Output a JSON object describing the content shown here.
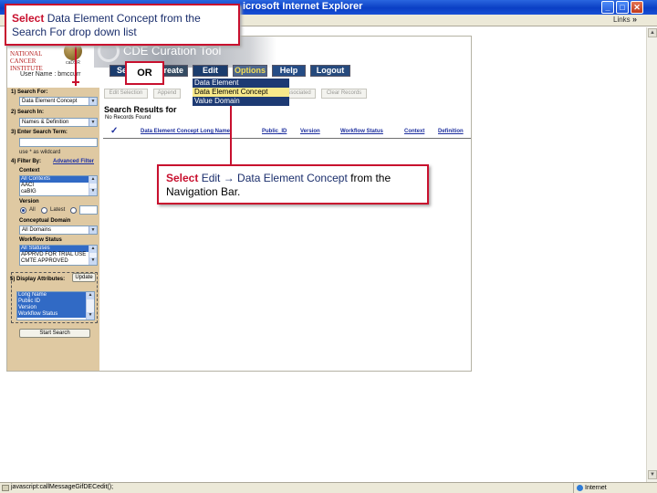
{
  "window": {
    "title": "CDE Curation Tool - Microsoft Internet Explorer",
    "visible_title": "icrosoft Internet Explorer"
  },
  "ie": {
    "links_label": "Links",
    "chevron": "»"
  },
  "header": {
    "nci_logo_text": "NATIONAL CANCER INSTITUTE",
    "cadsr_label": "caDSR",
    "app_title": "CDE Curation Tool",
    "username": "User Name : bmccurr"
  },
  "nav": {
    "search_label": "Search",
    "create_label": "Create",
    "edit_label": "Edit",
    "options_label": "Options",
    "help_label": "Help",
    "logout_label": "Logout",
    "dropdown": [
      {
        "label": "Data Element",
        "highlighted": false
      },
      {
        "label": "Data Element Concept",
        "highlighted": true
      },
      {
        "label": "Value Domain",
        "highlighted": false
      }
    ]
  },
  "left_panel": {
    "search_for_label": "1) Search For:",
    "search_for_value": "Data Element Concept",
    "search_in_label": "2) Search In:",
    "search_in_value": "Names & Definition",
    "search_term_label": "3) Enter Search Term:",
    "wildcard_note": "use * as wildcard",
    "filter_by_label": "4) Filter By:",
    "advanced_filter_link": "Advanced Filter",
    "context_label": "Context",
    "context_options": [
      "All Contexts",
      "AACI",
      "caBIG"
    ],
    "version_label": "Version",
    "version_all": "All",
    "version_latest": "Latest",
    "conceptual_domain_label": "Conceptual Domain",
    "conceptual_domain_value": "All Domains",
    "workflow_status_label": "Workflow Status",
    "workflow_options": [
      "All Statuses",
      "APPRVD FOR TRIAL USE",
      "CMTE APPROVED"
    ],
    "display_attributes_label": "5) Display Attributes:",
    "update_button": "Update",
    "attribute_options": [
      "Long Name",
      "Public ID",
      "Version",
      "Workflow Status"
    ],
    "start_search_button": "Start Search"
  },
  "toolbar": {
    "edit_selection": "Edit Selection",
    "append": "Append",
    "associated": "Associated",
    "clear_records": "Clear Records"
  },
  "results": {
    "title": "Search Results for",
    "no_records": "No Records Found",
    "check_icon": "✓",
    "columns": [
      "Data Element Concept Long Name",
      "Public_ID",
      "Version",
      "Workflow Status",
      "Context",
      "Definition"
    ]
  },
  "annotations": {
    "top": {
      "keyword": "Select",
      "text": " Data Element Concept from the Search For drop down list"
    },
    "or_label": "OR",
    "mid": {
      "keyword": "Select",
      "text_a": " Edit ",
      "arrow": "→",
      "text_b": " Data Element Concept",
      "text_c": " from the Navigation Bar."
    }
  },
  "status_bar": {
    "message": "javascript:callMessageGifDECedit();",
    "zone": "Internet"
  },
  "colors": {
    "accent_red": "#c8102e",
    "nav_blue": "#1d3a73",
    "panel_tan": "#dfc9a2",
    "highlight_yellow": "#f8e98a"
  }
}
